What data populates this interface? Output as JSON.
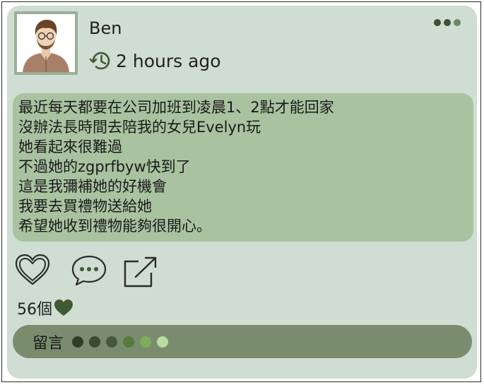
{
  "post": {
    "author": "Ben",
    "time_ago": "2 hours ago",
    "message_lines": [
      "最近每天都要在公司加班到凌晨1、2點才能回家",
      "沒辦法長時間去陪我的女兒Evelyn玩",
      "她看起來很難過",
      "不過她的zgprfbyw快到了",
      "這是我彌補她的好機會",
      "我要去買禮物送給她",
      "希望她收到禮物能夠很開心。"
    ],
    "likes_text": "56個",
    "comment_label": "留言",
    "more_dot_colors": [
      "#3f5138",
      "#3f5138",
      "#6a8a5c"
    ],
    "comment_dot_colors": [
      "#2f3d2a",
      "#3a4a33",
      "#45573c",
      "#557a3c",
      "#7fae58",
      "#b9dca0"
    ]
  },
  "colors": {
    "card_bg": "#cfddd3",
    "message_bg": "#a9c2a0",
    "comment_bar_bg": "#7a8c6e",
    "icon_green": "#3f5a33",
    "icon_dark": "#2b2b2b"
  },
  "icons": {
    "more": "more-horizontal-icon",
    "history": "history-clock-icon",
    "like": "heart-outline-icon",
    "comment": "chat-bubble-icon",
    "share": "share-external-icon",
    "likes_heart": "heart-filled-icon"
  }
}
